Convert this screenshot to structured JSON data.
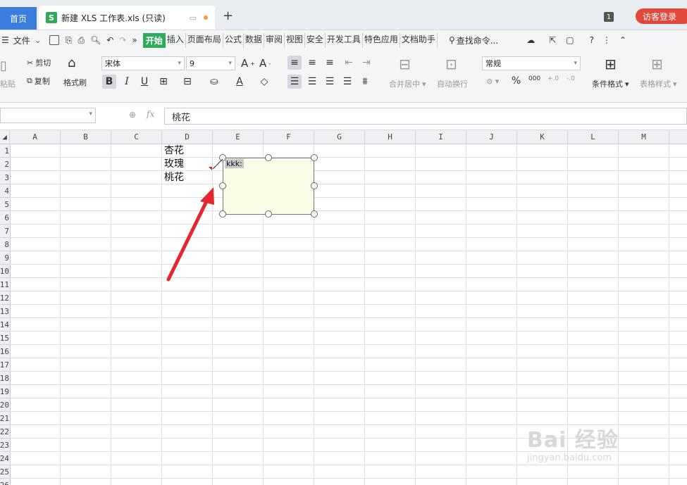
{
  "tabs": {
    "home": "首页",
    "document": "新建 XLS 工作表.xls (只读)",
    "document_logo": "S",
    "new_tab": "+"
  },
  "account": {
    "badge": "1",
    "login": "访客登录"
  },
  "menu": {
    "file": "文件",
    "items": [
      "开始",
      "插入",
      "页面布局",
      "公式",
      "数据",
      "审阅",
      "视图",
      "安全",
      "开发工具",
      "特色应用",
      "文档助手"
    ],
    "active_index": 0,
    "search": "查找命令..."
  },
  "ribbon": {
    "paste": "粘贴",
    "cut": "剪切",
    "copy": "复制",
    "format_painter": "格式刷",
    "font_name": "宋体",
    "font_size": "9",
    "bold": "B",
    "italic": "I",
    "underline": "U",
    "merge_center": "合并居中",
    "wrap_text": "自动换行",
    "number_format": "常规",
    "percent": "%",
    "conditional_format": "条件格式",
    "table_style": "表格样式"
  },
  "formula_bar": {
    "fx": "fx",
    "value": "桃花"
  },
  "grid": {
    "columns": [
      "A",
      "B",
      "C",
      "D",
      "E",
      "F",
      "G",
      "H",
      "I",
      "J",
      "K",
      "L",
      "M"
    ],
    "rows": [
      "1",
      "2",
      "3",
      "4",
      "5",
      "6",
      "7",
      "8",
      "9",
      "10",
      "11",
      "12",
      "13",
      "14",
      "15",
      "16",
      "17",
      "18",
      "19",
      "20",
      "21",
      "22",
      "23",
      "24",
      "25",
      "26"
    ],
    "cells": [
      {
        "col": "D",
        "row": 1,
        "value": "杏花"
      },
      {
        "col": "D",
        "row": 2,
        "value": "玫瑰"
      },
      {
        "col": "D",
        "row": 3,
        "value": "桃花"
      }
    ]
  },
  "comment": {
    "author": "kkk:",
    "text": ""
  },
  "watermark": {
    "main": "Bai 经验",
    "sub": "jingyan.baidu.com"
  },
  "colors": {
    "accent": "#2faa5b",
    "home_tab": "#3b7ddd",
    "login": "#e0493c",
    "arrow": "#e5262e",
    "comment_bg": "#fcfde8"
  }
}
